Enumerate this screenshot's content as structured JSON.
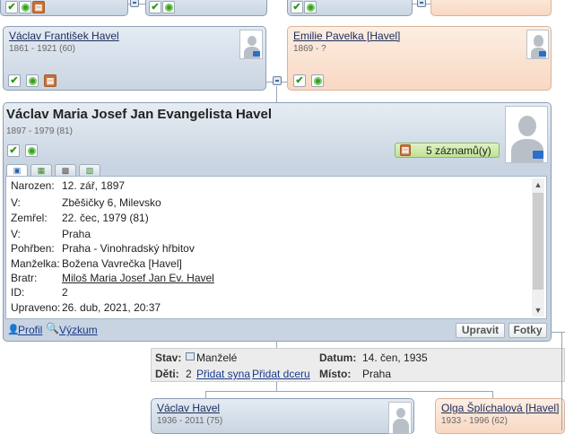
{
  "colors": {
    "accent": "#1a3a8a",
    "male_card": "#c9d5e2",
    "female_card": "#f8d8c2",
    "records_badge": "#c9ea9a"
  },
  "father": {
    "name": "Václav František Havel",
    "dates": "1861 - 1921 (60)"
  },
  "mother": {
    "name": "Emilie Pavelka [Havel]",
    "dates": "1869 - ?"
  },
  "main": {
    "name": "Václav Maria Josef Jan Evangelista Havel",
    "dates": "1897 - 1979 (81)",
    "records": "5 záznamů(y)"
  },
  "details": [
    {
      "key": "Narozen:",
      "value": "12. zář, 1897"
    },
    {
      "key": "V:",
      "value": "Zběšičky 6, Milevsko"
    },
    {
      "key": "Zemřel:",
      "value": "22. čec, 1979 (81)"
    },
    {
      "key": "V:",
      "value": "Praha"
    },
    {
      "key": "Pohřben:",
      "value": "Praha - Vinohradský hřbitov"
    },
    {
      "key": "Manželka:",
      "value": "Božena Vavrečka [Havel]"
    },
    {
      "key": "Bratr:",
      "value": "Miloš Maria Josef Jan Ev. Havel"
    },
    {
      "key": "ID:",
      "value": "2"
    },
    {
      "key": "Upraveno:",
      "value": "26. dub, 2021, 20:37"
    }
  ],
  "actions": {
    "profile": "Profil",
    "research": "Výzkum",
    "edit": "Upravit",
    "photos": "Fotky"
  },
  "family": {
    "status_label": "Stav:",
    "status_value": "Manželé",
    "date_label": "Datum:",
    "date_value": "14. čen, 1935",
    "children_label": "Děti:",
    "children_count": "2",
    "add_son": "Přidat syna",
    "add_daughter": "Přidat dceru",
    "place_label": "Místo:",
    "place_value": "Praha"
  },
  "child1": {
    "name": "Václav Havel",
    "dates": "1936 - 2011 (75)"
  },
  "child2": {
    "name": "Olga Šplíchalová [Havel]",
    "dates": "1933 - 1996 (62)"
  },
  "icons": [
    "check-icon",
    "circle-icon",
    "document-icon",
    "camera-icon",
    "profile-icon",
    "search-icon",
    "marriage-icon"
  ]
}
